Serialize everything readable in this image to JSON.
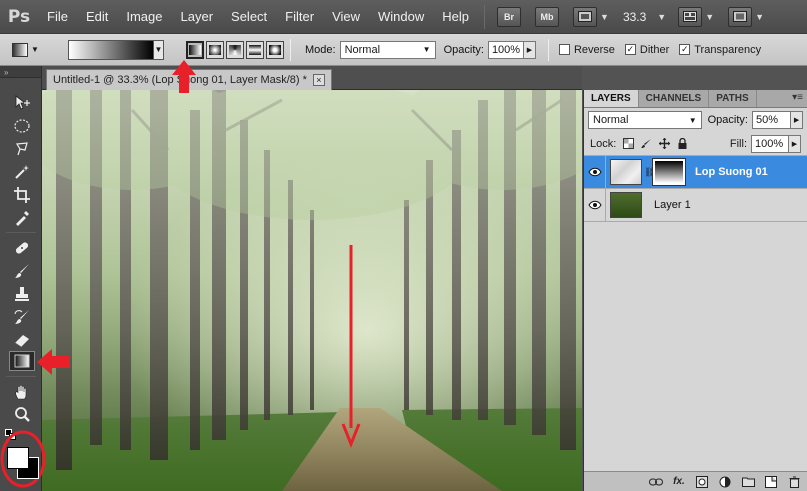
{
  "app": {
    "logo": "Ps"
  },
  "menu": [
    "File",
    "Edit",
    "Image",
    "Layer",
    "Select",
    "Filter",
    "View",
    "Window",
    "Help"
  ],
  "menubar_buttons": {
    "bridge": "Br",
    "minibridge": "Mb",
    "zoom": "33.3"
  },
  "options": {
    "mode_label": "Mode:",
    "mode_value": "Normal",
    "opacity_label": "Opacity:",
    "opacity_value": "100%",
    "reverse_label": "Reverse",
    "reverse_checked": false,
    "dither_label": "Dither",
    "dither_checked": true,
    "transparency_label": "Transparency",
    "transparency_checked": true
  },
  "document_tab": {
    "title": "Untitled-1 @ 33.3% (Lop Suong 01, Layer Mask/8) *",
    "close": "×"
  },
  "panel": {
    "tabs": [
      "LAYERS",
      "CHANNELS",
      "PATHS"
    ],
    "menu_glyph": "▾≡",
    "blend_mode": "Normal",
    "opacity_label": "Opacity:",
    "opacity_value": "50%",
    "lock_label": "Lock:",
    "fill_label": "Fill:",
    "fill_value": "100%",
    "layers": [
      {
        "name": "Lop Suong 01",
        "selected": true
      },
      {
        "name": "Layer 1",
        "selected": false
      }
    ],
    "footer_icons": [
      "link-icon",
      "fx-icon",
      "mask-icon",
      "adjustment-icon",
      "group-icon",
      "new-layer-icon",
      "trash-icon"
    ],
    "footer_fx": "fx."
  },
  "colors": {
    "accent": "#3a8be0",
    "annotation": "#e8202a"
  }
}
